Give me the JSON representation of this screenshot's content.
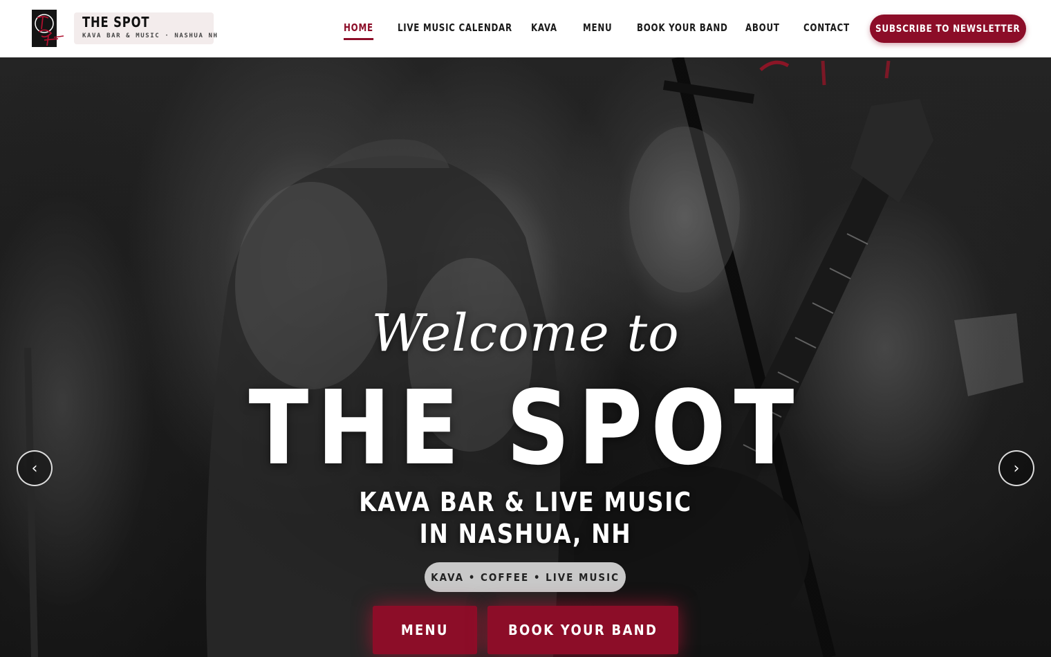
{
  "brand": {
    "title": "THE SPOT",
    "subtitle": "KAVA BAR & MUSIC · NASHUA NH",
    "logo_text": "The Spot"
  },
  "nav": {
    "items": [
      {
        "label": "HOME",
        "active": true
      },
      {
        "label": "LIVE MUSIC CALENDAR",
        "active": false
      },
      {
        "label": "KAVA",
        "active": false
      },
      {
        "label": "MENU",
        "active": false
      },
      {
        "label": "BOOK YOUR BAND",
        "active": false
      },
      {
        "label": "ABOUT",
        "active": false
      },
      {
        "label": "CONTACT",
        "active": false
      }
    ],
    "subscribe_label": "SUBSCRIBE TO NEWSLETTER"
  },
  "hero": {
    "welcome": "Welcome to",
    "title": "THE SPOT",
    "subtitle_line1": "KAVA BAR & LIVE MUSIC",
    "subtitle_line2": "IN NASHUA, NH",
    "tagline": "KAVA • COFFEE • LIVE MUSIC",
    "cta_menu": "MENU",
    "cta_book": "BOOK YOUR BAND",
    "prev_arrow": "‹",
    "next_arrow": "›"
  },
  "colors": {
    "accent": "#8c0d28",
    "header_bg": "#ffffff",
    "pill_bg": "#c8c8c8"
  },
  "icons": {
    "logo": "the-spot-logo-icon",
    "prev": "chevron-left-icon",
    "next": "chevron-right-icon"
  }
}
